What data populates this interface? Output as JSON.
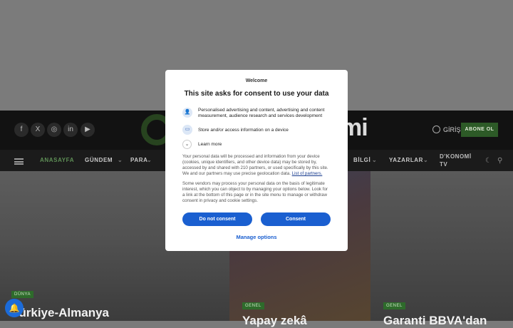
{
  "header": {
    "logo_text": "mi",
    "login_label": "GİRİŞ",
    "subscribe_label": "ABONE OL",
    "social_icons": [
      "facebook-icon",
      "x-icon",
      "instagram-icon",
      "linkedin-icon",
      "youtube-icon"
    ]
  },
  "nav": {
    "items": [
      "ANASAYFA",
      "GÜNDEM",
      "PARA",
      "BİLGİ",
      "YAZARLAR"
    ],
    "dk_line1": "D'KONOMİ",
    "dk_line2": "TV"
  },
  "cards": [
    {
      "tag": "DÜNYA",
      "title": "Türkiye-Almanya"
    },
    {
      "tag": "GENEL",
      "title": "Yapay zekâ"
    },
    {
      "tag": "GENEL",
      "title": "Garanti BBVA'dan"
    }
  ],
  "consent": {
    "welcome": "Welcome",
    "title": "This site asks for consent to use your data",
    "purpose1": "Personalised advertising and content, advertising and content measurement, audience research and services development",
    "purpose2": "Store and/or access information on a device",
    "learn_more": "Learn more",
    "para1": "Your personal data will be processed and information from your device (cookies, unique identifiers, and other device data) may be stored by, accessed by and shared with 210 partners, or used specifically by this site. We and our partners may use precise geolocation data.",
    "partners_link": "List of partners.",
    "para2": "Some vendors may process your personal data on the basis of legitimate interest, which you can object to by managing your options below. Look for a link at the bottom of this page or in the site menu to manage or withdraw consent in privacy and cookie settings.",
    "do_not_consent": "Do not consent",
    "consent": "Consent",
    "manage_options": "Manage options"
  },
  "colors": {
    "accent_green": "#2d5a27",
    "button_blue": "#1a5fd0"
  }
}
